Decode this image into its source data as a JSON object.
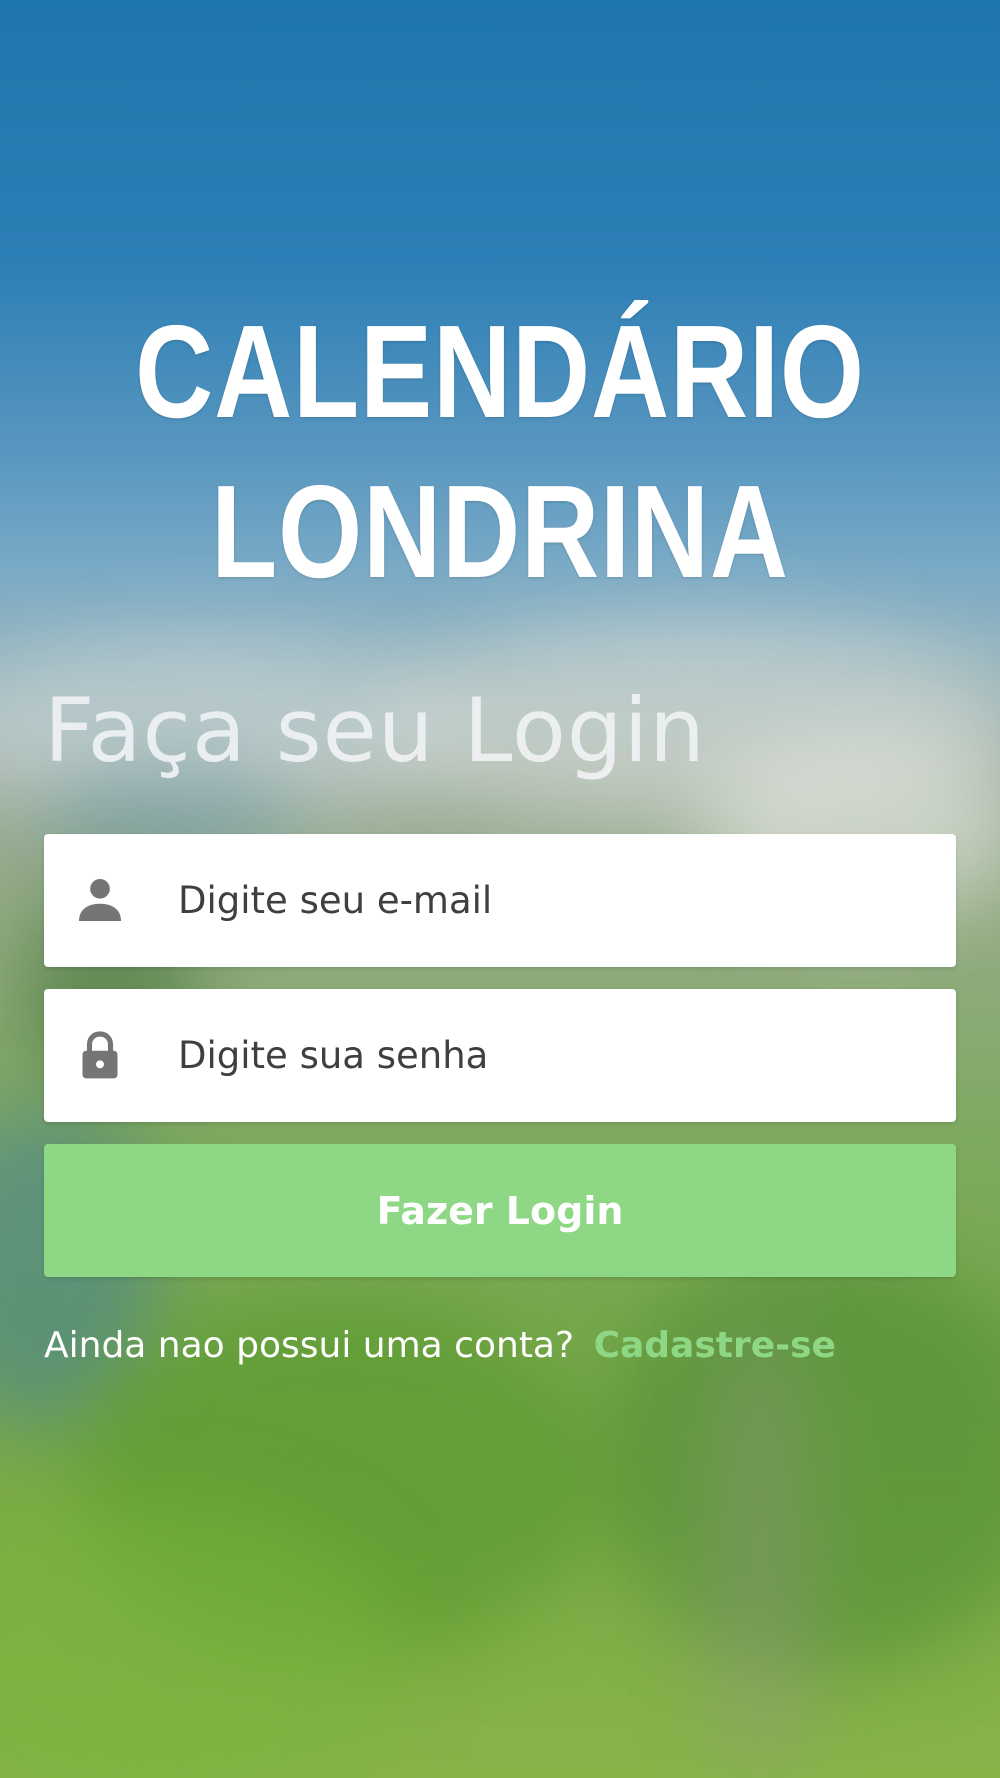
{
  "app": {
    "title_line1": "CALENDÁRIO",
    "title_line2": "LONDRINA"
  },
  "login": {
    "heading": "Faça seu Login",
    "email_placeholder": "Digite seu e-mail",
    "password_placeholder": "Digite sua senha",
    "email_icon": "person-icon",
    "password_icon": "lock-icon",
    "submit_label": "Fazer Login"
  },
  "signup": {
    "prompt": "Ainda nao possui uma conta?",
    "link_label": "Cadastre-se"
  },
  "colors": {
    "accent": "#8dd785",
    "icon": "#757575",
    "sky": "#1f76ac"
  }
}
